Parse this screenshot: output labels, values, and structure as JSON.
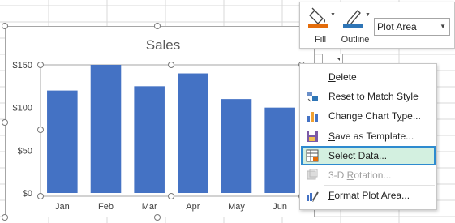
{
  "chart": {
    "title": "Sales",
    "bar_color": "#4472c4"
  },
  "chart_data": {
    "type": "bar",
    "title": "Sales",
    "categories": [
      "Jan",
      "Feb",
      "Mar",
      "Apr",
      "May",
      "Jun"
    ],
    "values": [
      120,
      150,
      125,
      140,
      110,
      100
    ],
    "ylim": [
      0,
      150
    ],
    "yticks": [
      "$0",
      "$50",
      "$100",
      "$150"
    ],
    "grid": false,
    "legend": "none"
  },
  "toolbar": {
    "fill_label": "Fill",
    "outline_label": "Outline",
    "element_select_value": "Plot Area",
    "fill_icon": "paint-bucket-icon",
    "outline_icon": "pen-icon",
    "accent_color": "#e46c0a",
    "outline_color": "#2e75b6"
  },
  "context_menu": {
    "items": [
      {
        "label": "Delete",
        "underline": "D",
        "rest": "elete",
        "icon": "none",
        "state": "normal"
      },
      {
        "label": "Reset to Match Style",
        "underline": "",
        "pre": "Reset to M",
        "u": "a",
        "post": "tch Style",
        "icon": "reset-style-icon",
        "state": "normal"
      },
      {
        "label": "Change Chart Type...",
        "pre": "Change Chart T",
        "u": "y",
        "post": "pe...",
        "icon": "chart-type-icon",
        "state": "normal"
      },
      {
        "label": "Save as Template...",
        "pre": "",
        "u": "S",
        "post": "ave as Template...",
        "icon": "save-template-icon",
        "state": "normal"
      },
      {
        "label": "Select Data...",
        "pre": "Select Data...",
        "u": "",
        "post": "",
        "icon": "select-data-icon",
        "state": "selected"
      },
      {
        "label": "3-D Rotation...",
        "pre": "3-D ",
        "u": "R",
        "post": "otation...",
        "icon": "rotation-icon",
        "state": "disabled"
      },
      {
        "label": "Format Plot Area...",
        "pre": "",
        "u": "F",
        "post": "ormat Plot Area...",
        "icon": "format-plot-icon",
        "state": "normal"
      }
    ]
  }
}
